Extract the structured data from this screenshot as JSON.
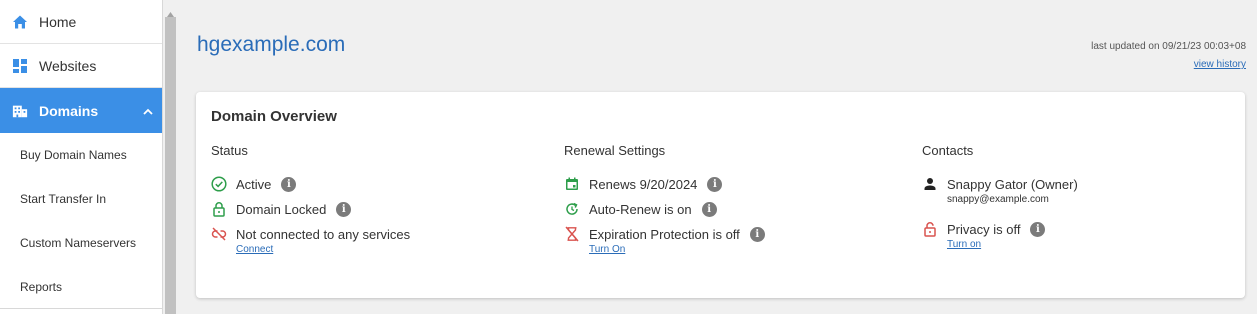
{
  "sidebar": {
    "home": "Home",
    "websites": "Websites",
    "domains": "Domains",
    "sub": [
      "Buy Domain Names",
      "Start Transfer In",
      "Custom Nameservers",
      "Reports"
    ]
  },
  "header": {
    "domain": "hgexample.com",
    "last_updated": "last updated on 09/21/23 00:03+08",
    "view_history": "view history"
  },
  "card": {
    "title": "Domain Overview",
    "status": {
      "heading": "Status",
      "active": "Active",
      "locked": "Domain Locked",
      "not_connected": "Not connected to any services",
      "connect": "Connect"
    },
    "renewal": {
      "heading": "Renewal Settings",
      "renews": "Renews 9/20/2024",
      "auto_renew": "Auto-Renew is on",
      "expiration": "Expiration Protection is off",
      "turn_on": "Turn On"
    },
    "contacts": {
      "heading": "Contacts",
      "owner": "Snappy Gator (Owner)",
      "email": "snappy@example.com",
      "privacy": "Privacy is off",
      "turn_on": "Turn on"
    }
  },
  "colors": {
    "accent": "#3b8fe6",
    "link": "#2a6cb8",
    "green": "#2e9e4b",
    "red": "#d9534f"
  }
}
